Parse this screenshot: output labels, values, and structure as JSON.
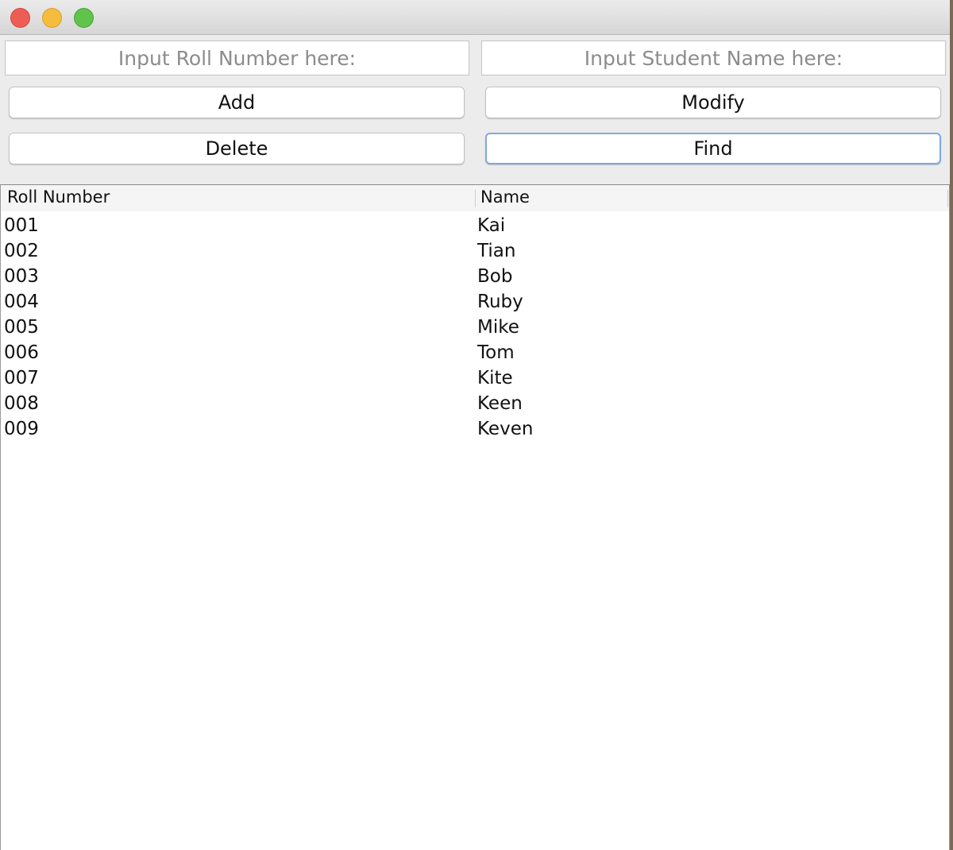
{
  "window": {
    "controls": [
      "close",
      "minimize",
      "zoom"
    ]
  },
  "form": {
    "roll_placeholder": "Input Roll Number here:",
    "name_placeholder": "Input Student Name here:",
    "roll_value": "",
    "name_value": ""
  },
  "buttons": {
    "add": "Add",
    "modify": "Modify",
    "delete": "Delete",
    "find": "Find"
  },
  "table": {
    "columns": [
      "Roll Number",
      "Name"
    ],
    "rows": [
      [
        "001",
        "Kai"
      ],
      [
        "002",
        "Tian"
      ],
      [
        "003",
        "Bob"
      ],
      [
        "004",
        "Ruby"
      ],
      [
        "005",
        "Mike"
      ],
      [
        "006",
        "Tom"
      ],
      [
        "007",
        "Kite"
      ],
      [
        "008",
        "Keen"
      ],
      [
        "009",
        "Keven"
      ]
    ]
  },
  "colors": {
    "close": "#ee5d55",
    "minimize": "#f6bc3e",
    "zoom": "#5fc34c",
    "focus_ring": "#7ea9de"
  }
}
